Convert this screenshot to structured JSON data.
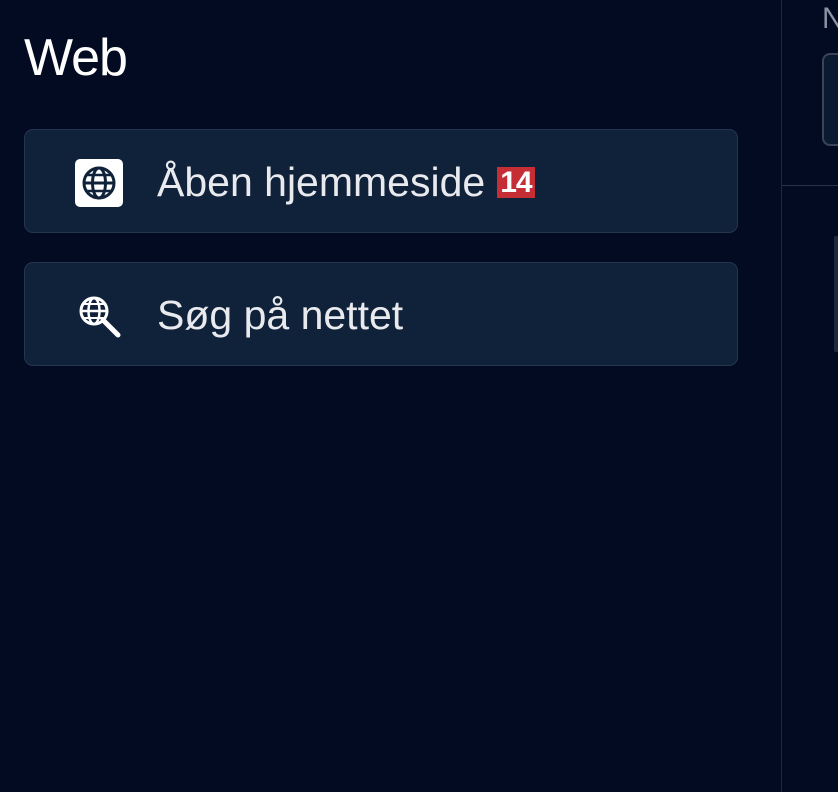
{
  "section": {
    "title": "Web"
  },
  "actions": [
    {
      "label": "Åben hjemmeside",
      "icon": "globe-icon",
      "badge": "14"
    },
    {
      "label": "Søg på nettet",
      "icon": "globe-search-icon"
    }
  ],
  "right_panel": {
    "label_fragment": "N"
  },
  "colors": {
    "background": "#020b22",
    "card": "#10213a",
    "badge": "#c42e34"
  }
}
